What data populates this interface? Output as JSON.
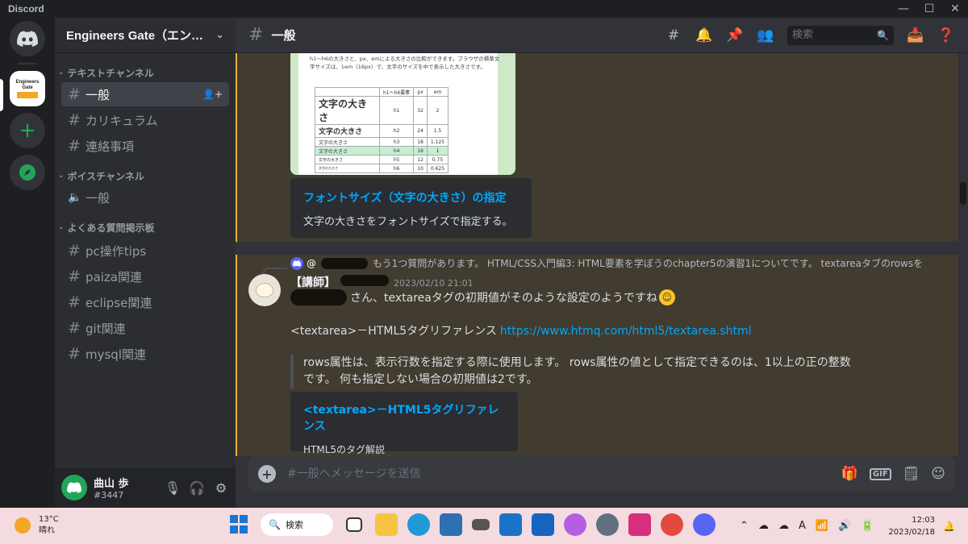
{
  "window": {
    "app_name": "Discord",
    "controls": [
      "—",
      "☐",
      "✕"
    ]
  },
  "servers": {
    "home_label": "Discord",
    "eg_lines": [
      "Engineers",
      "Gate"
    ],
    "add_label": "+"
  },
  "guild": {
    "name": "Engineers Gate（エンジ...",
    "chevron": "⌄"
  },
  "sidebar": {
    "categories": [
      {
        "name": "テキストチャンネル",
        "channels": [
          "一般",
          "カリキュラム",
          "連絡事項"
        ]
      },
      {
        "name": "ボイスチャンネル",
        "channels": [
          "一般"
        ]
      },
      {
        "name": "よくある質問掲示板",
        "channels": [
          "pc操作tips",
          "paiza関連",
          "eclipse関連",
          "git関連",
          "mysql関連"
        ]
      }
    ]
  },
  "user": {
    "name": "曲山 歩",
    "tag": "#3447"
  },
  "channel_header": {
    "name": "一般",
    "search_placeholder": "検索"
  },
  "image_card": {
    "intro": "h1～h6の大きさと、px、emによる大きさの比較ができます。ブラウザの標準文字サイズは、1em（16px）で、文字のサイズを中で表示した大きさです。",
    "table_headers": [
      "",
      "h1～h6要素",
      "px",
      "em"
    ],
    "rows": [
      [
        "文字の大きさ",
        "h1",
        "32",
        "2"
      ],
      [
        "文字の大きさ",
        "h2",
        "24",
        "1.5"
      ],
      [
        "文字の大きさ",
        "h3",
        "18",
        "1.125"
      ],
      [
        "文字の大きさ",
        "h4",
        "16",
        "1"
      ],
      [
        "文字の大きさ",
        "h5",
        "12",
        "0.75"
      ],
      [
        "文字の大きさ",
        "h6",
        "10",
        "0.625"
      ]
    ]
  },
  "embed1": {
    "title": "フォントサイズ（文字の大きさ）の指定",
    "description": "文字の大きさをフォントサイズで指定する。"
  },
  "reply": {
    "name": "@",
    "text": "もう1つ質問があります。 HTML/CSS入門編3: HTML要素を学ぼうのchapter5の演習1についてです。 textareaタブのrowsを"
  },
  "message": {
    "author": "【講師】",
    "timestamp": "2023/02/10 21:01",
    "line1": "さん、textareaタグの初期値がそのような設定のようですね",
    "line2_text": "<textarea>－HTML5タグリファレンス",
    "line2_link": "https://www.htmq.com/html5/textarea.shtml",
    "quote": "rows属性は、表示行数を指定する際に使用します。 rows属性の値として指定できるのは、1以上の正の整数です。 何も指定しない場合の初期値は2です。"
  },
  "embed2": {
    "title": "<textarea>－HTML5タグリファレンス",
    "description": "HTML5のタグ解説"
  },
  "composer": {
    "placeholder": "#一般へメッセージを送信",
    "gif_label": "GIF"
  },
  "taskbar": {
    "temp": "13°C",
    "weather": "晴れ",
    "search_label": "検索",
    "time": "12:03",
    "date": "2023/02/18",
    "ime": "A"
  },
  "colors": {
    "accent": "#5865f2",
    "link": "#00a8fc",
    "highlight_border": "#f0b132",
    "online": "#23a559"
  }
}
